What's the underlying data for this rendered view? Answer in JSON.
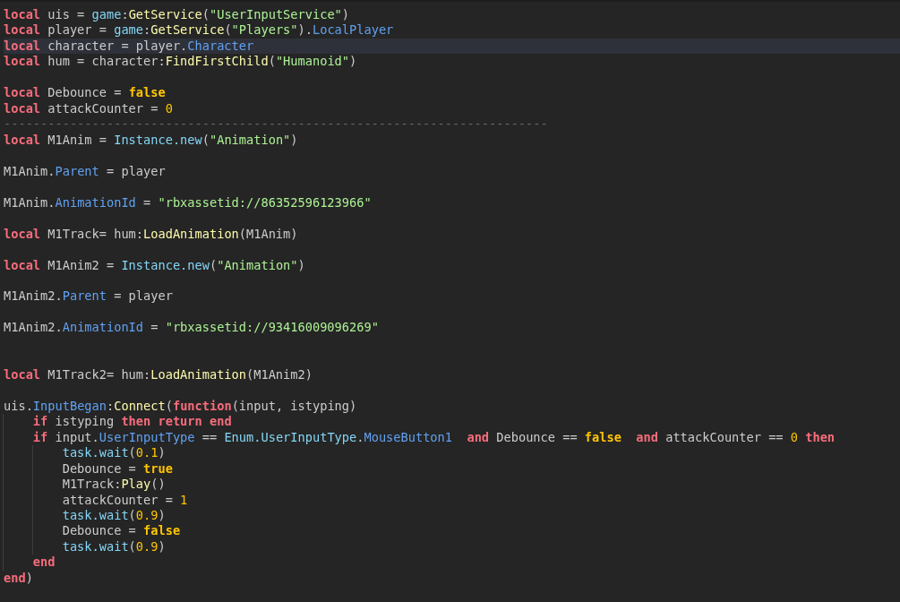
{
  "editor": {
    "lines": [
      {
        "kind": "code",
        "current": false,
        "tokens": [
          {
            "kind": "keyword",
            "text": "local"
          },
          {
            "kind": "plain",
            "text": " uis = "
          },
          {
            "kind": "builtin",
            "text": "game"
          },
          {
            "kind": "plain",
            "text": ":"
          },
          {
            "kind": "method",
            "text": "GetService"
          },
          {
            "kind": "plain",
            "text": "("
          },
          {
            "kind": "string",
            "text": "\"UserInputService\""
          },
          {
            "kind": "plain",
            "text": ")"
          }
        ]
      },
      {
        "kind": "code",
        "current": false,
        "tokens": [
          {
            "kind": "keyword",
            "text": "local"
          },
          {
            "kind": "plain",
            "text": " player = "
          },
          {
            "kind": "builtin",
            "text": "game"
          },
          {
            "kind": "plain",
            "text": ":"
          },
          {
            "kind": "method",
            "text": "GetService"
          },
          {
            "kind": "plain",
            "text": "("
          },
          {
            "kind": "string",
            "text": "\"Players\""
          },
          {
            "kind": "plain",
            "text": ")."
          },
          {
            "kind": "property",
            "text": "LocalPlayer"
          }
        ]
      },
      {
        "kind": "code",
        "current": true,
        "tokens": [
          {
            "kind": "keyword",
            "text": "local"
          },
          {
            "kind": "plain",
            "text": " character = player."
          },
          {
            "kind": "property",
            "text": "Character"
          }
        ]
      },
      {
        "kind": "code",
        "current": false,
        "tokens": [
          {
            "kind": "keyword",
            "text": "local"
          },
          {
            "kind": "plain",
            "text": " hum = character:"
          },
          {
            "kind": "method",
            "text": "FindFirstChild"
          },
          {
            "kind": "plain",
            "text": "("
          },
          {
            "kind": "string",
            "text": "\"Humanoid\""
          },
          {
            "kind": "plain",
            "text": ")"
          }
        ]
      },
      {
        "kind": "blank"
      },
      {
        "kind": "code",
        "current": false,
        "tokens": [
          {
            "kind": "keyword",
            "text": "local"
          },
          {
            "kind": "plain",
            "text": " Debounce = "
          },
          {
            "kind": "bool",
            "text": "false"
          }
        ]
      },
      {
        "kind": "code",
        "current": false,
        "tokens": [
          {
            "kind": "keyword",
            "text": "local"
          },
          {
            "kind": "plain",
            "text": " attackCounter = "
          },
          {
            "kind": "number",
            "text": "0"
          }
        ]
      },
      {
        "kind": "code",
        "current": false,
        "tokens": [
          {
            "kind": "comment",
            "text": "--------------------------------------------------------------------------"
          }
        ]
      },
      {
        "kind": "code",
        "current": false,
        "tokens": [
          {
            "kind": "keyword",
            "text": "local"
          },
          {
            "kind": "plain",
            "text": " M1Anim = "
          },
          {
            "kind": "builtin",
            "text": "Instance.new"
          },
          {
            "kind": "plain",
            "text": "("
          },
          {
            "kind": "string",
            "text": "\"Animation\""
          },
          {
            "kind": "plain",
            "text": ")"
          }
        ]
      },
      {
        "kind": "blank"
      },
      {
        "kind": "code",
        "current": false,
        "tokens": [
          {
            "kind": "plain",
            "text": "M1Anim."
          },
          {
            "kind": "property",
            "text": "Parent"
          },
          {
            "kind": "plain",
            "text": " = player"
          }
        ]
      },
      {
        "kind": "blank"
      },
      {
        "kind": "code",
        "current": false,
        "tokens": [
          {
            "kind": "plain",
            "text": "M1Anim."
          },
          {
            "kind": "property",
            "text": "AnimationId"
          },
          {
            "kind": "plain",
            "text": " = "
          },
          {
            "kind": "string",
            "text": "\"rbxassetid://86352596123966\""
          }
        ]
      },
      {
        "kind": "blank"
      },
      {
        "kind": "code",
        "current": false,
        "tokens": [
          {
            "kind": "keyword",
            "text": "local"
          },
          {
            "kind": "plain",
            "text": " M1Track= hum:"
          },
          {
            "kind": "method",
            "text": "LoadAnimation"
          },
          {
            "kind": "plain",
            "text": "(M1Anim)"
          }
        ]
      },
      {
        "kind": "blank"
      },
      {
        "kind": "code",
        "current": false,
        "tokens": [
          {
            "kind": "keyword",
            "text": "local"
          },
          {
            "kind": "plain",
            "text": " M1Anim2 = "
          },
          {
            "kind": "builtin",
            "text": "Instance.new"
          },
          {
            "kind": "plain",
            "text": "("
          },
          {
            "kind": "string",
            "text": "\"Animation\""
          },
          {
            "kind": "plain",
            "text": ")"
          }
        ]
      },
      {
        "kind": "blank"
      },
      {
        "kind": "code",
        "current": false,
        "tokens": [
          {
            "kind": "plain",
            "text": "M1Anim2."
          },
          {
            "kind": "property",
            "text": "Parent"
          },
          {
            "kind": "plain",
            "text": " = player"
          }
        ]
      },
      {
        "kind": "blank"
      },
      {
        "kind": "code",
        "current": false,
        "tokens": [
          {
            "kind": "plain",
            "text": "M1Anim2."
          },
          {
            "kind": "property",
            "text": "AnimationId"
          },
          {
            "kind": "plain",
            "text": " = "
          },
          {
            "kind": "string",
            "text": "\"rbxassetid://93416009096269\""
          }
        ]
      },
      {
        "kind": "blank"
      },
      {
        "kind": "blank"
      },
      {
        "kind": "code",
        "current": false,
        "tokens": [
          {
            "kind": "keyword",
            "text": "local"
          },
          {
            "kind": "plain",
            "text": " M1Track2= hum:"
          },
          {
            "kind": "method",
            "text": "LoadAnimation"
          },
          {
            "kind": "plain",
            "text": "(M1Anim2)"
          }
        ]
      },
      {
        "kind": "blank"
      },
      {
        "kind": "code",
        "current": false,
        "tokens": [
          {
            "kind": "plain",
            "text": "uis."
          },
          {
            "kind": "property",
            "text": "InputBegan"
          },
          {
            "kind": "plain",
            "text": ":"
          },
          {
            "kind": "method",
            "text": "Connect"
          },
          {
            "kind": "plain",
            "text": "("
          },
          {
            "kind": "keyword",
            "text": "function"
          },
          {
            "kind": "plain",
            "text": "(input, istyping)"
          }
        ],
        "children": [
          {
            "kind": "code",
            "current": false,
            "tokens": [
              {
                "kind": "keyword",
                "text": "if"
              },
              {
                "kind": "plain",
                "text": " istyping "
              },
              {
                "kind": "keyword",
                "text": "then return end"
              }
            ]
          },
          {
            "kind": "code",
            "current": false,
            "tokens": [
              {
                "kind": "keyword",
                "text": "if"
              },
              {
                "kind": "plain",
                "text": " input."
              },
              {
                "kind": "property",
                "text": "UserInputType"
              },
              {
                "kind": "plain",
                "text": " == "
              },
              {
                "kind": "builtin",
                "text": "Enum.UserInputType"
              },
              {
                "kind": "plain",
                "text": "."
              },
              {
                "kind": "property",
                "text": "MouseButton1"
              },
              {
                "kind": "keyword",
                "text": "  and"
              },
              {
                "kind": "plain",
                "text": " Debounce == "
              },
              {
                "kind": "bool",
                "text": "false"
              },
              {
                "kind": "keyword",
                "text": "  and"
              },
              {
                "kind": "plain",
                "text": " attackCounter == "
              },
              {
                "kind": "number",
                "text": "0"
              },
              {
                "kind": "keyword",
                "text": " then"
              }
            ],
            "children": [
              {
                "kind": "code",
                "current": false,
                "tokens": [
                  {
                    "kind": "builtin",
                    "text": "task.wait"
                  },
                  {
                    "kind": "plain",
                    "text": "("
                  },
                  {
                    "kind": "number",
                    "text": "0.1"
                  },
                  {
                    "kind": "plain",
                    "text": ")"
                  }
                ]
              },
              {
                "kind": "code",
                "current": false,
                "tokens": [
                  {
                    "kind": "plain",
                    "text": "Debounce = "
                  },
                  {
                    "kind": "bool",
                    "text": "true"
                  }
                ]
              },
              {
                "kind": "code",
                "current": false,
                "tokens": [
                  {
                    "kind": "plain",
                    "text": "M1Track:"
                  },
                  {
                    "kind": "method",
                    "text": "Play"
                  },
                  {
                    "kind": "plain",
                    "text": "()"
                  }
                ]
              },
              {
                "kind": "code",
                "current": false,
                "tokens": [
                  {
                    "kind": "plain",
                    "text": "attackCounter = "
                  },
                  {
                    "kind": "number",
                    "text": "1"
                  }
                ]
              },
              {
                "kind": "code",
                "current": false,
                "tokens": [
                  {
                    "kind": "builtin",
                    "text": "task.wait"
                  },
                  {
                    "kind": "plain",
                    "text": "("
                  },
                  {
                    "kind": "number",
                    "text": "0.9"
                  },
                  {
                    "kind": "plain",
                    "text": ")"
                  }
                ]
              },
              {
                "kind": "code",
                "current": false,
                "tokens": [
                  {
                    "kind": "plain",
                    "text": "Debounce = "
                  },
                  {
                    "kind": "bool",
                    "text": "false"
                  }
                ]
              },
              {
                "kind": "code",
                "current": false,
                "tokens": [
                  {
                    "kind": "builtin",
                    "text": "task.wait"
                  },
                  {
                    "kind": "plain",
                    "text": "("
                  },
                  {
                    "kind": "number",
                    "text": "0.9"
                  },
                  {
                    "kind": "plain",
                    "text": ")"
                  }
                ]
              }
            ]
          },
          {
            "kind": "code",
            "current": false,
            "tokens": [
              {
                "kind": "keyword",
                "text": "end"
              }
            ]
          }
        ]
      },
      {
        "kind": "code",
        "current": false,
        "tokens": [
          {
            "kind": "keyword",
            "text": "end"
          },
          {
            "kind": "plain",
            "text": ")"
          }
        ]
      }
    ]
  }
}
